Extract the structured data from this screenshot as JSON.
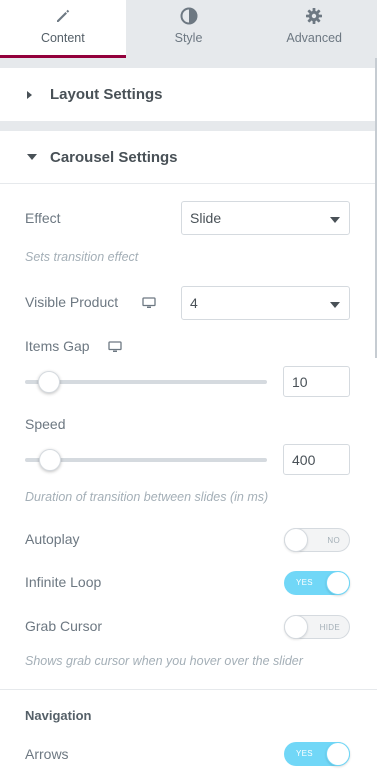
{
  "tabs": [
    {
      "label": "Content",
      "icon": "pencil-icon",
      "active": true
    },
    {
      "label": "Style",
      "icon": "half-circle-icon",
      "active": false
    },
    {
      "label": "Advanced",
      "icon": "gear-icon",
      "active": false
    }
  ],
  "sections": {
    "layout": {
      "title": "Layout Settings",
      "expanded": false
    },
    "carousel": {
      "title": "Carousel Settings",
      "expanded": true
    }
  },
  "controls": {
    "effect": {
      "label": "Effect",
      "value": "Slide",
      "description": "Sets transition effect"
    },
    "visible_product": {
      "label": "Visible Product",
      "value": "4",
      "responsive_icon": "desktop-icon"
    },
    "items_gap": {
      "label": "Items Gap",
      "value": "10",
      "responsive_icon": "desktop-icon"
    },
    "speed": {
      "label": "Speed",
      "value": "400",
      "description": "Duration of transition between slides (in ms)"
    },
    "autoplay": {
      "label": "Autoplay",
      "state": "NO",
      "on": false
    },
    "infinite_loop": {
      "label": "Infinite Loop",
      "state": "YES",
      "on": true
    },
    "grab_cursor": {
      "label": "Grab Cursor",
      "state": "HIDE",
      "on": false,
      "description": "Shows grab cursor when you hover over the slider"
    }
  },
  "navigation": {
    "heading": "Navigation",
    "arrows": {
      "label": "Arrows",
      "state": "YES",
      "on": true
    }
  },
  "colors": {
    "accent_tab": "#93003c",
    "toggle_on": "#71d7f7",
    "panel_bg": "#e6e9ec"
  }
}
